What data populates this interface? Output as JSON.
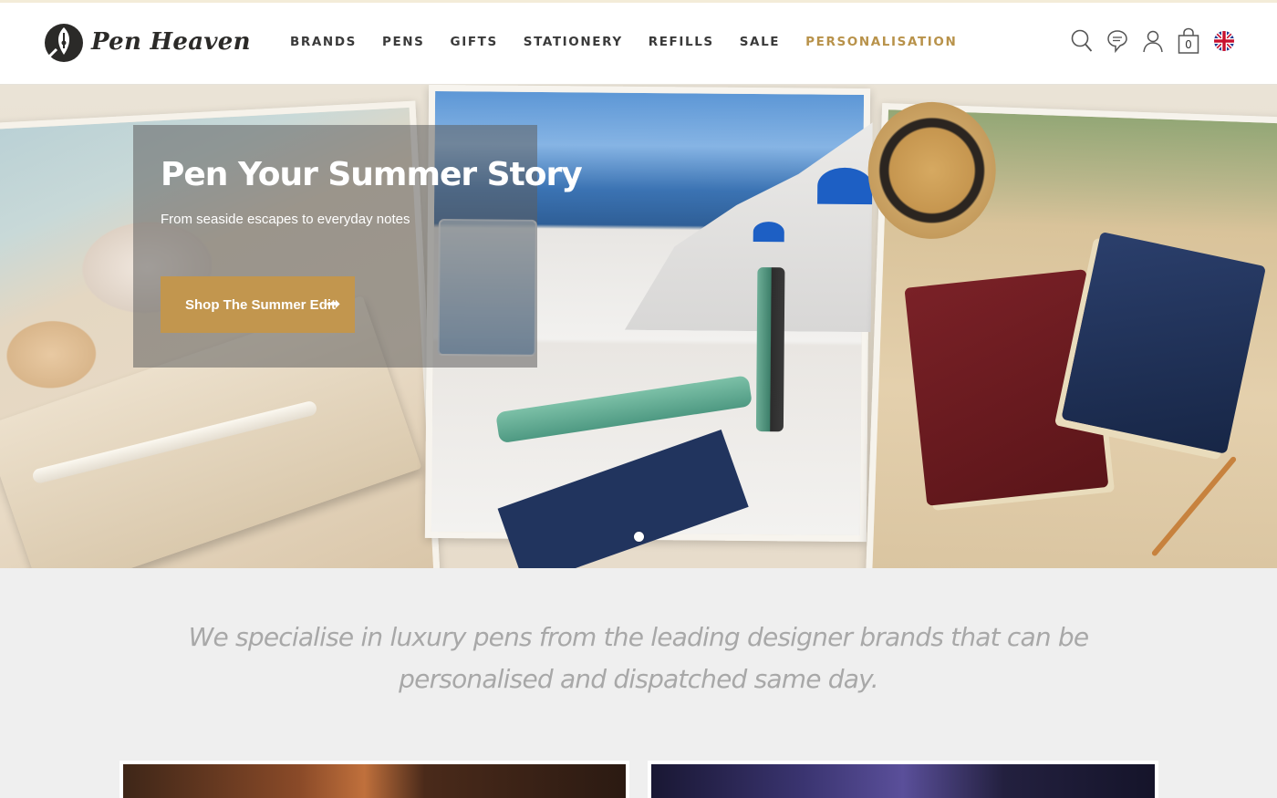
{
  "header": {
    "logo_text": "Pen Heaven",
    "nav": [
      {
        "label": "BRANDS"
      },
      {
        "label": "PENS"
      },
      {
        "label": "GIFTS"
      },
      {
        "label": "STATIONERY"
      },
      {
        "label": "REFILLS"
      },
      {
        "label": "SALE"
      },
      {
        "label": "PERSONALISATION",
        "accent": true
      }
    ],
    "icons": [
      "search-icon",
      "chat-icon",
      "account-icon",
      "cart-icon",
      "uk-flag-icon"
    ],
    "cart_count": "0"
  },
  "hero": {
    "title": "Pen Your Summer Story",
    "subtitle": "From seaside escapes to everyday notes",
    "button_label": "Shop The Summer Edit",
    "button_arrow": "➞"
  },
  "tagline": "We specialise in luxury pens from the leading designer brands that can be personalised and dispatched same day.",
  "colors": {
    "accent": "#c2964e",
    "nav_accent": "#b8924a",
    "tagline": "#a8a8a8"
  }
}
